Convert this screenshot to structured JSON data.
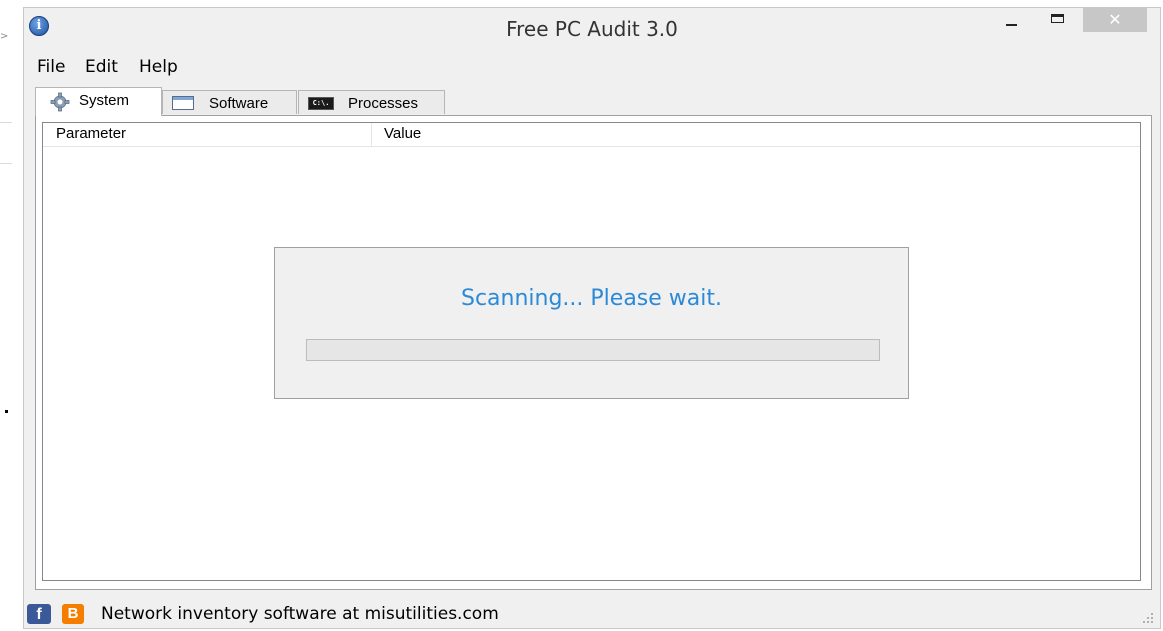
{
  "window": {
    "title": "Free PC Audit 3.0",
    "close_glyph": "✕",
    "app_icon_glyph": "i",
    "icons": [
      "info-icon",
      "minimize-icon",
      "maximize-icon",
      "close-icon"
    ]
  },
  "menu": {
    "items": [
      "File",
      "Edit",
      "Help"
    ]
  },
  "tabs": [
    {
      "label": "System",
      "icon": "gear-icon",
      "active": true
    },
    {
      "label": "Software",
      "icon": "window-icon",
      "active": false
    },
    {
      "label": "Processes",
      "icon": "cmd-icon",
      "active": false
    }
  ],
  "cmd_icon_text": "C:\\.",
  "table": {
    "columns": [
      "Parameter",
      "Value"
    ],
    "rows": []
  },
  "scan": {
    "message": "Scanning... Please wait.",
    "progress": 0
  },
  "status": {
    "text": "Network inventory software at misutilities.com",
    "facebook_glyph": "f",
    "blogger_glyph": "B"
  },
  "colors": {
    "scan_text": "#2b8ad8",
    "facebook": "#3b5998",
    "blogger": "#f57d00",
    "close_button": "#c7c7c7"
  }
}
